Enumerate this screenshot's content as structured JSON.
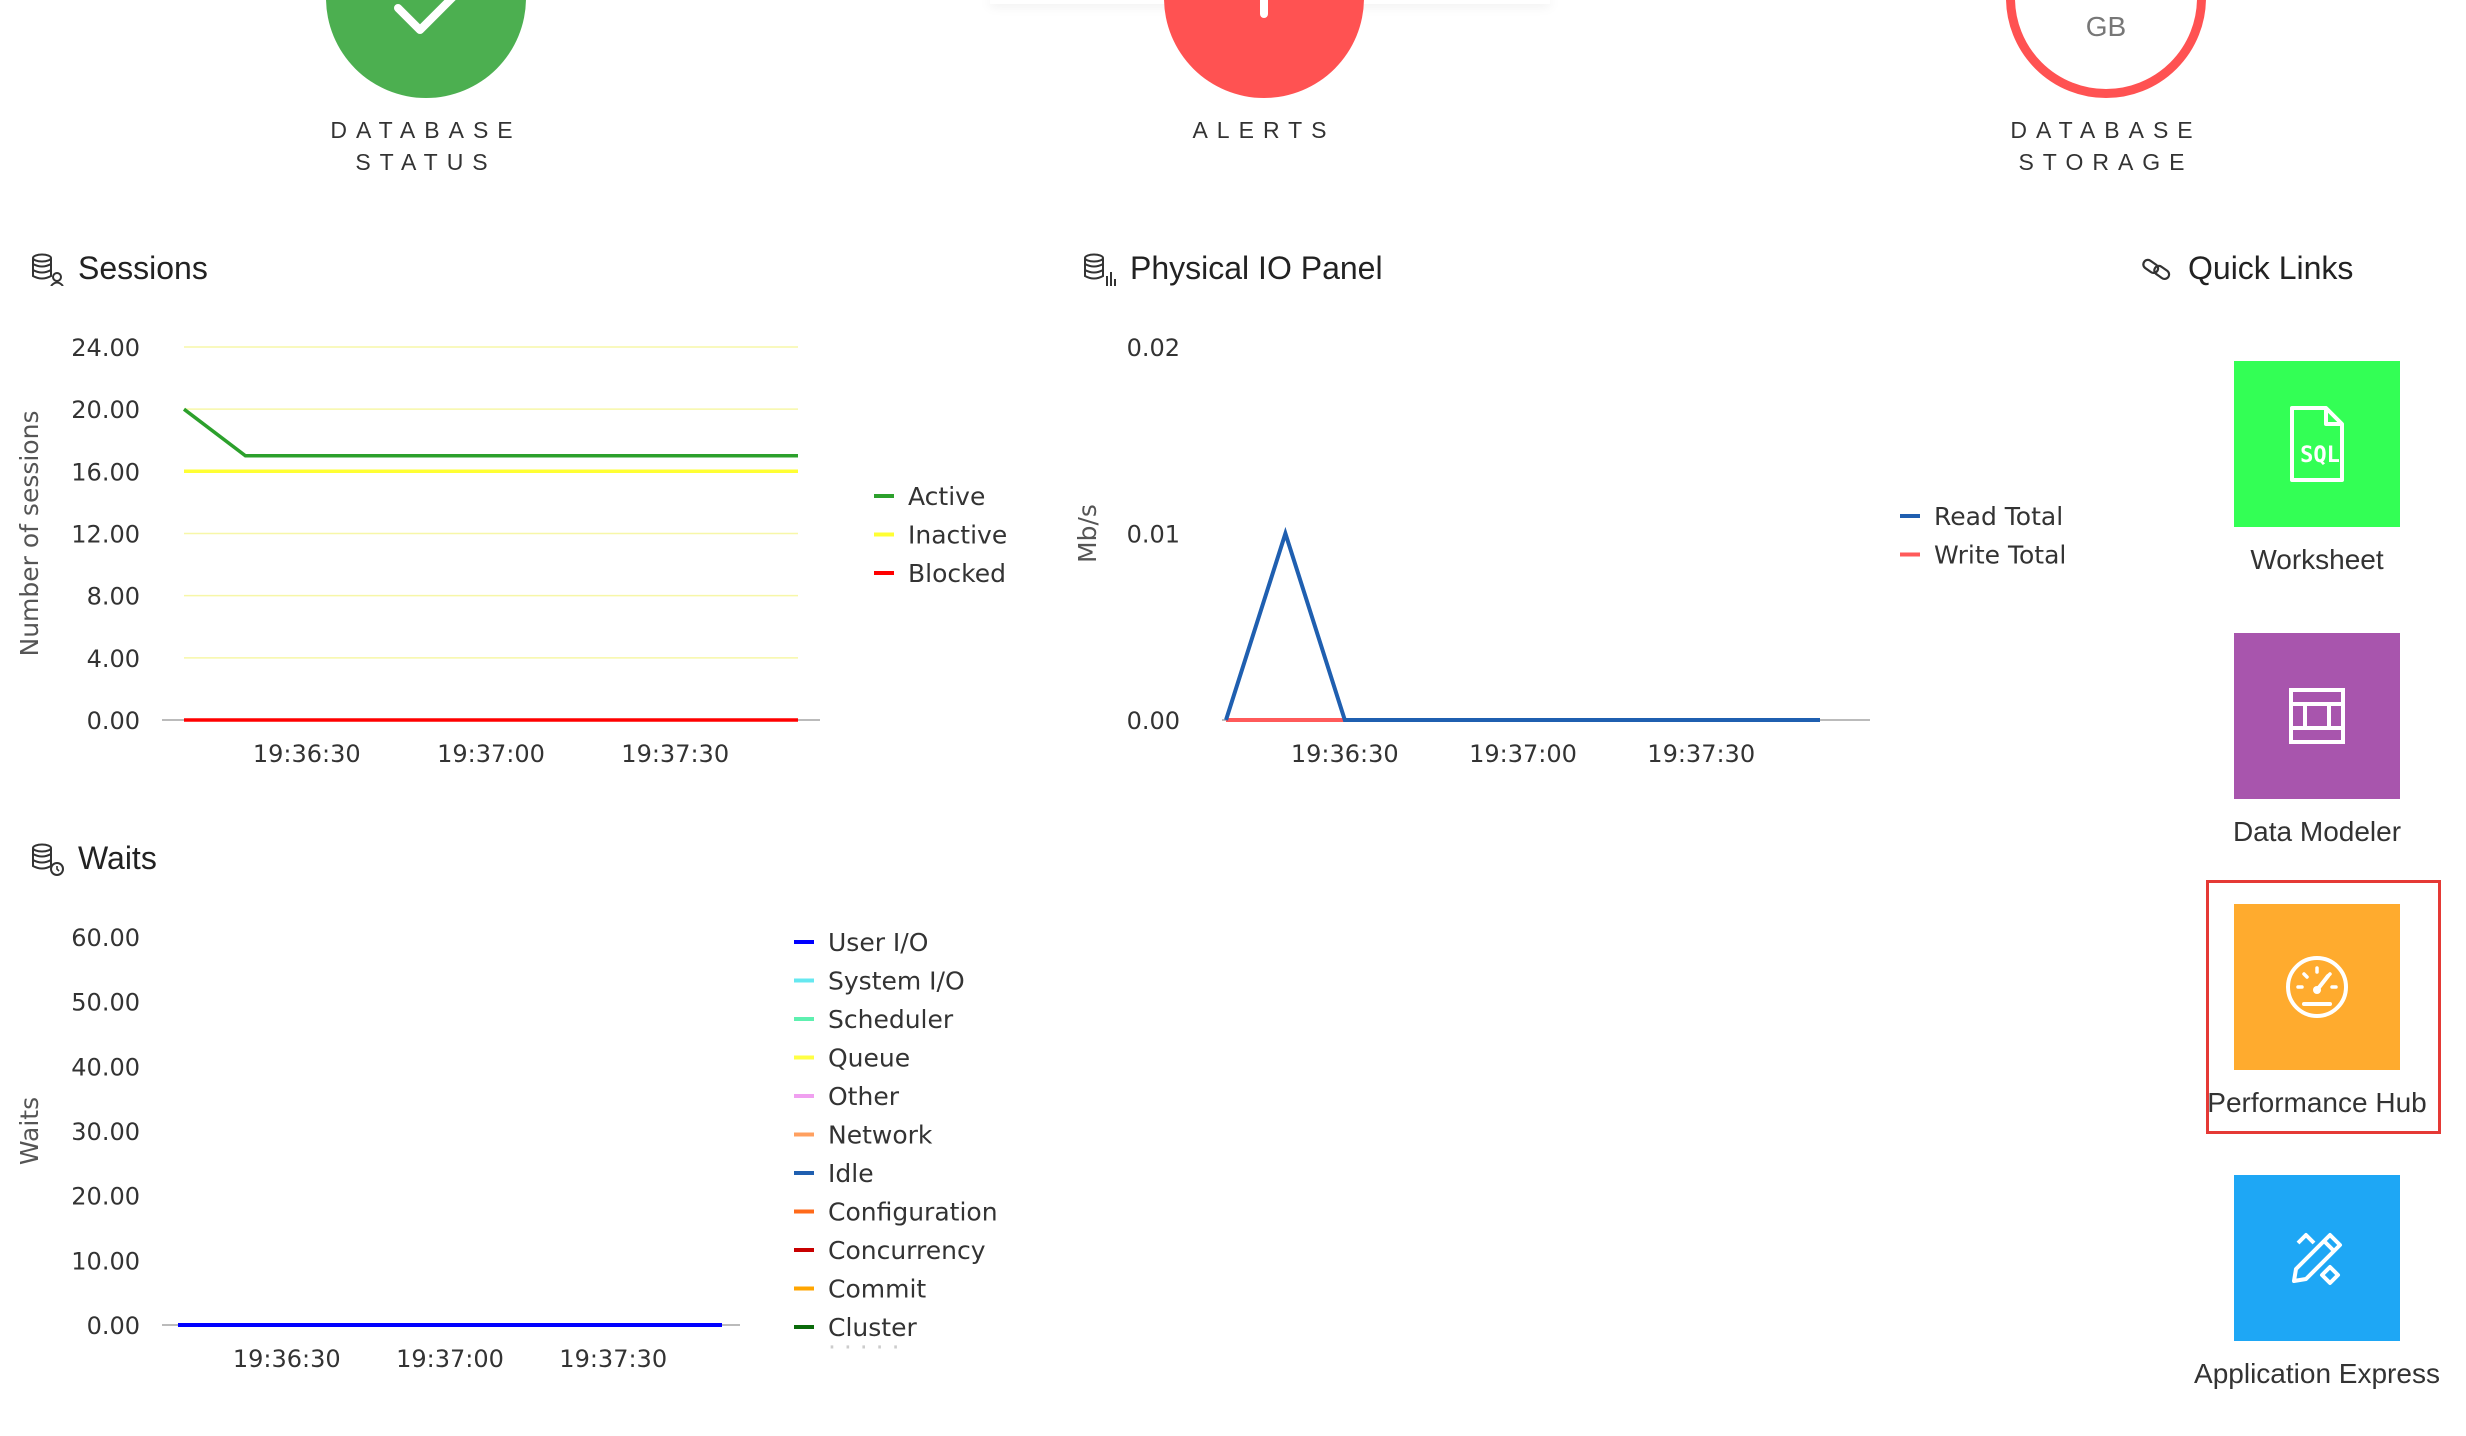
{
  "status": {
    "database_status": {
      "label_line1": "DATABASE",
      "label_line2": "STATUS",
      "color": "#4caf50"
    },
    "alerts": {
      "label_line1": "ALERTS",
      "color": "#ff5252"
    },
    "database_storage": {
      "label_line1": "DATABASE",
      "label_line2": "STORAGE",
      "unit": "GB",
      "color": "#ff5252"
    }
  },
  "sessions": {
    "title": "Sessions",
    "chart_data": {
      "type": "line",
      "title": "Sessions",
      "ylabel": "Number of sessions",
      "xlabel": "",
      "ylim": [
        0,
        24
      ],
      "yticks": [
        "24.00",
        "20.00",
        "16.00",
        "12.00",
        "8.00",
        "4.00",
        "0.00"
      ],
      "xticks": [
        "19:36:30",
        "19:37:00",
        "19:37:30"
      ],
      "x": [
        "19:36:10",
        "19:36:20",
        "19:36:30",
        "19:36:40",
        "19:36:50",
        "19:37:00",
        "19:37:10",
        "19:37:20",
        "19:37:30",
        "19:37:40",
        "19:37:50"
      ],
      "series": [
        {
          "name": "Active",
          "color": "#2ca02c",
          "values": [
            20,
            17,
            17,
            17,
            17,
            17,
            17,
            17,
            17,
            17,
            17
          ]
        },
        {
          "name": "Inactive",
          "color": "#ffff33",
          "values": [
            16,
            16,
            16,
            16,
            16,
            16,
            16,
            16,
            16,
            16,
            16
          ]
        },
        {
          "name": "Blocked",
          "color": "#ff0000",
          "values": [
            0,
            0,
            0,
            0,
            0,
            0,
            0,
            0,
            0,
            0,
            0
          ]
        }
      ]
    }
  },
  "physical_io": {
    "title": "Physical IO Panel",
    "chart_data": {
      "type": "line",
      "title": "Physical IO Panel",
      "ylabel": "Mb/s",
      "xlabel": "",
      "ylim": [
        0,
        0.02
      ],
      "yticks": [
        "0.02",
        "0.01",
        "0.00"
      ],
      "xticks": [
        "19:36:30",
        "19:37:00",
        "19:37:30"
      ],
      "x": [
        "19:36:10",
        "19:36:20",
        "19:36:30",
        "19:36:40",
        "19:36:50",
        "19:37:00",
        "19:37:10",
        "19:37:20",
        "19:37:30",
        "19:37:40",
        "19:37:50"
      ],
      "series": [
        {
          "name": "Read Total",
          "color": "#1f5fb0",
          "values": [
            0,
            0.01,
            0,
            0,
            0,
            0,
            0,
            0,
            0,
            0,
            0
          ]
        },
        {
          "name": "Write Total",
          "color": "#ff5a5a",
          "values": [
            0,
            0,
            0,
            0,
            0,
            0,
            0,
            0,
            0,
            0,
            0
          ]
        }
      ]
    }
  },
  "waits": {
    "title": "Waits",
    "chart_data": {
      "type": "line",
      "title": "Waits",
      "ylabel": "Waits",
      "xlabel": "",
      "ylim": [
        0,
        60
      ],
      "yticks": [
        "60.00",
        "50.00",
        "40.00",
        "30.00",
        "20.00",
        "10.00",
        "0.00"
      ],
      "xticks": [
        "19:36:30",
        "19:37:00",
        "19:37:30"
      ],
      "x": [
        "19:36:10",
        "19:36:20",
        "19:36:30",
        "19:36:40",
        "19:36:50",
        "19:37:00",
        "19:37:10",
        "19:37:20",
        "19:37:30",
        "19:37:40",
        "19:37:50"
      ],
      "series": [
        {
          "name": "User I/O",
          "color": "#0000ff",
          "values": [
            0,
            0,
            0,
            0,
            0,
            0,
            0,
            0,
            0,
            0,
            0
          ]
        },
        {
          "name": "System I/O",
          "color": "#66e8f0",
          "values": [
            0,
            0,
            0,
            0,
            0,
            0,
            0,
            0,
            0,
            0,
            0
          ]
        },
        {
          "name": "Scheduler",
          "color": "#5ef0b0",
          "values": [
            0,
            0,
            0,
            0,
            0,
            0,
            0,
            0,
            0,
            0,
            0
          ]
        },
        {
          "name": "Queue",
          "color": "#ffff44",
          "values": [
            0,
            0,
            0,
            0,
            0,
            0,
            0,
            0,
            0,
            0,
            0
          ]
        },
        {
          "name": "Other",
          "color": "#f0a0f0",
          "values": [
            0,
            0,
            0,
            0,
            0,
            0,
            0,
            0,
            0,
            0,
            0
          ]
        },
        {
          "name": "Network",
          "color": "#ffa060",
          "values": [
            0,
            0,
            0,
            0,
            0,
            0,
            0,
            0,
            0,
            0,
            0
          ]
        },
        {
          "name": "Idle",
          "color": "#1f5fb0",
          "values": [
            0,
            0,
            0,
            0,
            0,
            0,
            0,
            0,
            0,
            0,
            0
          ]
        },
        {
          "name": "Configuration",
          "color": "#ff6a1a",
          "values": [
            0,
            0,
            0,
            0,
            0,
            0,
            0,
            0,
            0,
            0,
            0
          ]
        },
        {
          "name": "Concurrency",
          "color": "#c80000",
          "values": [
            0,
            0,
            0,
            0,
            0,
            0,
            0,
            0,
            0,
            0,
            0
          ]
        },
        {
          "name": "Commit",
          "color": "#ffa500",
          "values": [
            0,
            0,
            0,
            0,
            0,
            0,
            0,
            0,
            0,
            0,
            0
          ]
        },
        {
          "name": "Cluster",
          "color": "#0a6a0a",
          "values": [
            0,
            0,
            0,
            0,
            0,
            0,
            0,
            0,
            0,
            0,
            0
          ]
        }
      ]
    }
  },
  "quick_links": {
    "title": "Quick Links",
    "items": [
      {
        "label": "Worksheet",
        "color": "#33ff55",
        "icon": "sql-file-icon",
        "icon_text": "SQL"
      },
      {
        "label": "Data Modeler",
        "color": "#a855ad",
        "icon": "data-modeler-icon"
      },
      {
        "label": "Performance Hub",
        "color": "#ffab2e",
        "icon": "speedometer-icon"
      },
      {
        "label": "Application Express",
        "color": "#1ea7f5",
        "icon": "pencil-ruler-icon"
      }
    ]
  }
}
